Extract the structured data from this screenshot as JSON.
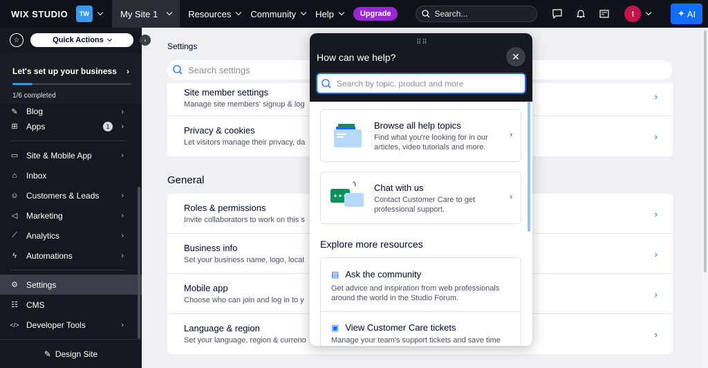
{
  "topbar": {
    "logo": "WIX STUDIO",
    "workspace_initials": "TW",
    "site_name": "My Site 1",
    "nav": [
      "Resources",
      "Community",
      "Help"
    ],
    "upgrade": "Upgrade",
    "search_placeholder": "Search...",
    "avatar_initial": "t",
    "ai_label": "AI"
  },
  "sidebar": {
    "quick_actions": "Quick Actions",
    "setup_title": "Let's set up your business",
    "setup_progress": "1/6 completed",
    "setup_fraction": 0.17,
    "items": [
      {
        "label": "Blog",
        "icon": "blog-icon"
      },
      {
        "label": "Apps",
        "icon": "apps-icon",
        "badge": "1"
      },
      {
        "label": "Site & Mobile App",
        "icon": "site-icon"
      },
      {
        "label": "Inbox",
        "icon": "inbox-icon"
      },
      {
        "label": "Customers & Leads",
        "icon": "customers-icon"
      },
      {
        "label": "Marketing",
        "icon": "marketing-icon"
      },
      {
        "label": "Analytics",
        "icon": "analytics-icon"
      },
      {
        "label": "Automations",
        "icon": "automations-icon"
      },
      {
        "label": "Settings",
        "icon": "settings-icon"
      },
      {
        "label": "CMS",
        "icon": "cms-icon"
      },
      {
        "label": "Developer Tools",
        "icon": "code-icon"
      }
    ],
    "design_site": "Design Site"
  },
  "main": {
    "title": "Settings",
    "search_placeholder": "Search settings",
    "top_rows": [
      {
        "title": "Site member settings",
        "sub": "Manage site members' signup & log"
      },
      {
        "title": "Privacy & cookies",
        "sub": "Let visitors manage their privacy, da"
      }
    ],
    "general_heading": "General",
    "general_rows": [
      {
        "title": "Roles & permissions",
        "sub": "Invite collaborators to work on this s"
      },
      {
        "title": "Business info",
        "sub": "Set your business name, logo, locat"
      },
      {
        "title": "Mobile app",
        "sub": "Choose who can join and log in to y"
      },
      {
        "title": "Language & region",
        "sub": "Set your language, region & curreno"
      }
    ]
  },
  "help": {
    "title": "How can we help?",
    "search_placeholder": "Search by topic, product and more",
    "cards": [
      {
        "title": "Browse all help topics",
        "sub": "Find what you're looking for in our articles, video tutorials and more."
      },
      {
        "title": "Chat with us",
        "sub": "Contact Customer Care to get professional support."
      }
    ],
    "explore_heading": "Explore more resources",
    "resources": [
      {
        "title": "Ask the community",
        "sub": "Get advice and inspiration from web professionals around the world in the Studio Forum."
      },
      {
        "title": "View Customer Care tickets",
        "sub": "Manage your team's support tickets and save time"
      }
    ]
  }
}
